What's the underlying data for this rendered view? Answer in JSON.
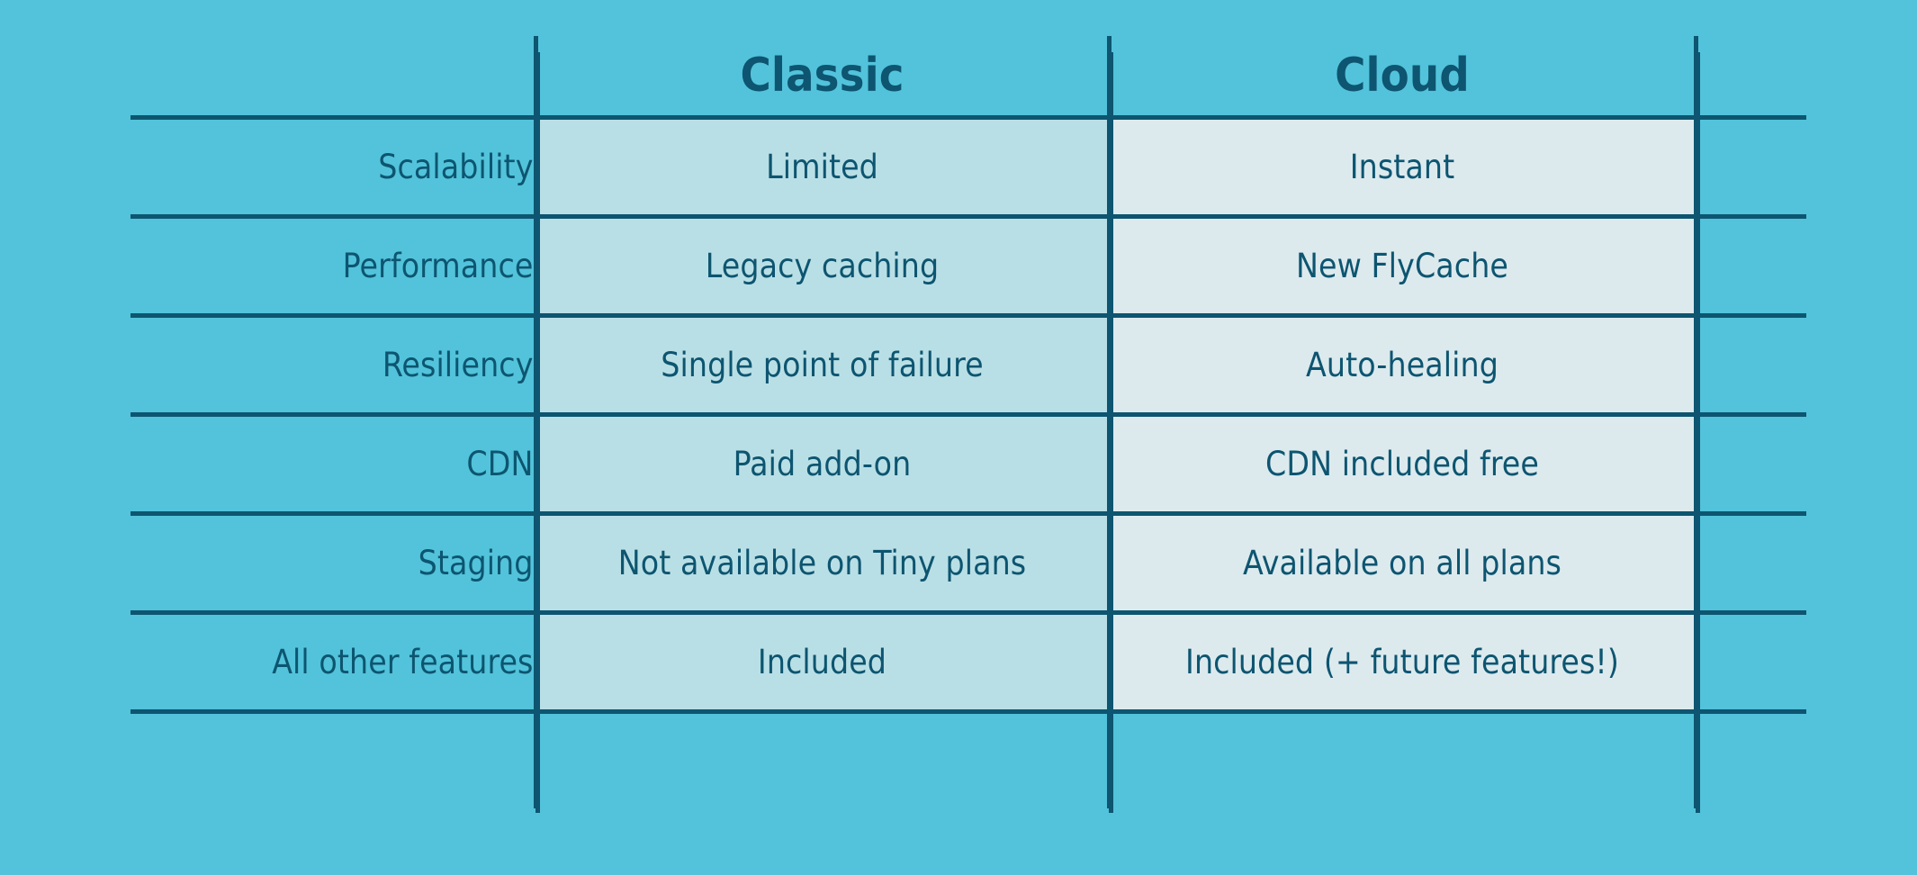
{
  "theme": {
    "background": "#52c3db",
    "line_color": "#0d5570",
    "text_color": "#0d5570",
    "classic_cell_fill": "#b9dfe6",
    "cloud_cell_fill": "#dceaee"
  },
  "table": {
    "headers": {
      "feature": "",
      "classic": "Classic",
      "cloud": "Cloud",
      "extra": ""
    },
    "rows": [
      {
        "feature": "Scalability",
        "classic": "Limited",
        "cloud": "Instant"
      },
      {
        "feature": "Performance",
        "classic": "Legacy caching",
        "cloud": "New FlyCache"
      },
      {
        "feature": "Resiliency",
        "classic": "Single point of failure",
        "cloud": "Auto-healing"
      },
      {
        "feature": "CDN",
        "classic": "Paid add-on",
        "cloud": "CDN included free"
      },
      {
        "feature": "Staging",
        "classic": "Not available on Tiny plans",
        "cloud": "Available on all plans"
      },
      {
        "feature": "All other features",
        "classic": "Included",
        "cloud": "Included (+ future features!)"
      }
    ],
    "trailing_row": {
      "feature": "",
      "classic": "",
      "cloud": "",
      "extra": ""
    }
  }
}
